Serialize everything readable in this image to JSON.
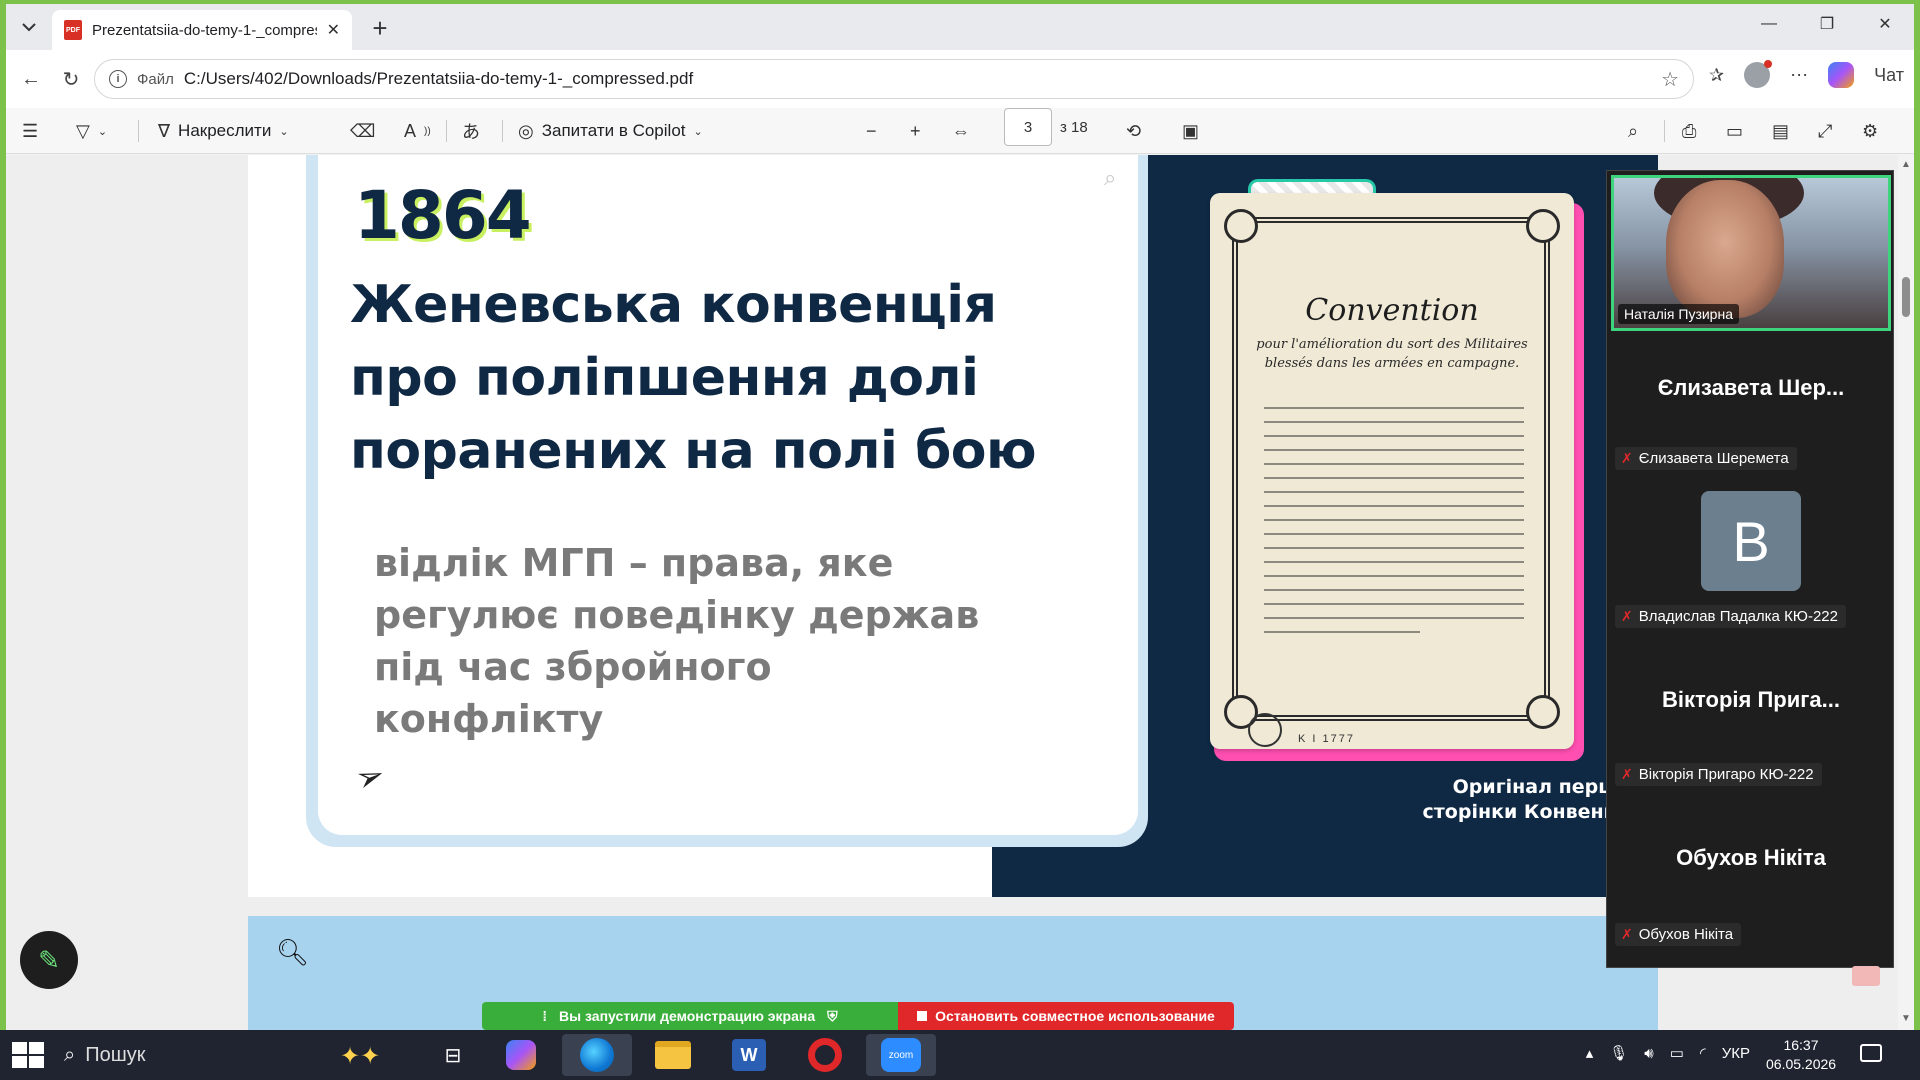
{
  "browser": {
    "tab_title": "Prezentatsiia-do-temy-1-_compres",
    "tab_favicon": "pdf-icon",
    "address_label": "Файл",
    "url": "C:/Users/402/Downloads/Prezentatsiia-do-temy-1-_compressed.pdf",
    "chat_label": "Чат"
  },
  "pdf_toolbar": {
    "draw_label": "Накреслити",
    "copilot_label": "Запитати в Copilot",
    "page_current": "3",
    "page_total": "з 18"
  },
  "slide": {
    "year": "1864",
    "headline_lines": [
      "Женевська конвенція",
      "про поліпшення долі",
      "поранених на полі бою"
    ],
    "subtext_lines": [
      "відлік МГП – права, яке",
      "регулює поведінку держав",
      "під час збройного конфлікту"
    ],
    "document_title": "Convention",
    "document_subtitle": "pour l'amélioration du sort des Militaires blessés dans les armées en campagne.",
    "document_code": "K I 1777",
    "caption_lines": [
      "Оригінал першої",
      "сторінки Конвенції."
    ]
  },
  "sharebar": {
    "started_text": "Вы запустили демонстрацию экрана",
    "stop_text": "Остановить совместное использование"
  },
  "zoom": {
    "participants": [
      {
        "video": true,
        "name": "Наталія Пузирна"
      },
      {
        "big_name": "Єлизавета  Шер...",
        "name": "Єлизавета Шеремета"
      },
      {
        "avatar_letter": "В",
        "name": "Владислав Падалка КЮ-222"
      },
      {
        "big_name": "Вікторія  Прига...",
        "name": "Вікторія Пригаро КЮ-222"
      },
      {
        "big_name": "Обухов Нікіта",
        "name": "Обухов Нікіта"
      }
    ]
  },
  "taskbar": {
    "search_placeholder": "Пошук",
    "language": "УКР",
    "time": "16:37",
    "date": "06.05.2026"
  },
  "colors": {
    "slide_navy": "#0f2844",
    "accent_pink": "#ff4fb0",
    "accent_lime": "#c8f060",
    "share_green": "#3aae3a",
    "share_red": "#e0282a"
  }
}
